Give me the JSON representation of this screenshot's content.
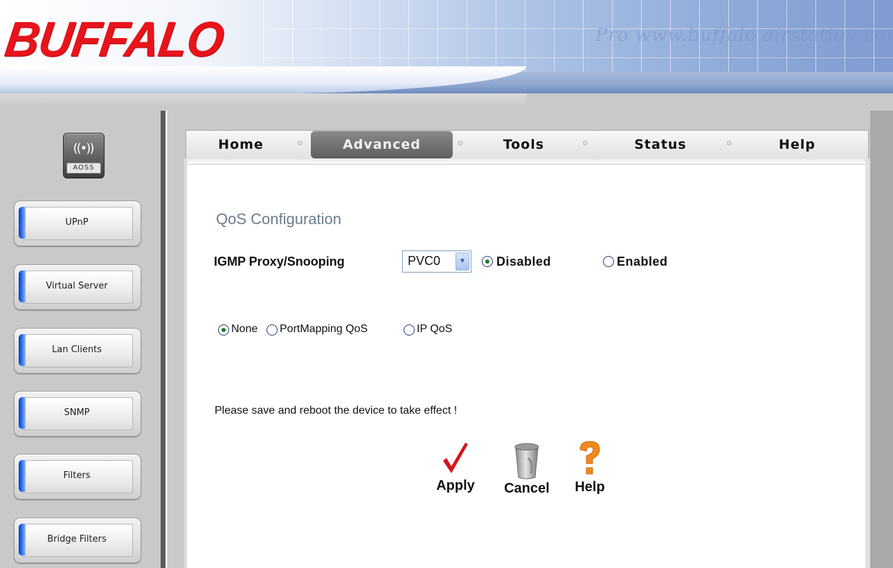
{
  "brand": {
    "logo_text": "BUFFALO",
    "header_script": "Pro www.buffalo airstation.com"
  },
  "sidebar": {
    "aoss_label": "AOSS",
    "items": [
      {
        "label": "UPnP"
      },
      {
        "label": "Virtual Server"
      },
      {
        "label": "Lan Clients"
      },
      {
        "label": "SNMP"
      },
      {
        "label": "Filters"
      },
      {
        "label": "Bridge Filters"
      }
    ]
  },
  "tabs": [
    {
      "label": "Home",
      "active": false
    },
    {
      "label": "Advanced",
      "active": true
    },
    {
      "label": "Tools",
      "active": false
    },
    {
      "label": "Status",
      "active": false
    },
    {
      "label": "Help",
      "active": false
    }
  ],
  "main": {
    "section_title": "QoS Configuration",
    "igmp": {
      "label": "IGMP Proxy/Snooping",
      "pvc_selected": "PVC0",
      "options": [
        {
          "label": "Disabled",
          "checked": true
        },
        {
          "label": "Enabled",
          "checked": false
        }
      ]
    },
    "qos_mode": {
      "options": [
        {
          "label": "None",
          "checked": true
        },
        {
          "label": "PortMapping QoS",
          "checked": false
        },
        {
          "label": "IP QoS",
          "checked": false
        }
      ]
    },
    "notice": "Please save and reboot the device to take effect !",
    "actions": {
      "apply": "Apply",
      "cancel": "Cancel",
      "help": "Help"
    }
  },
  "colors": {
    "logo": "#e8141b",
    "section_title": "#6c7b8c",
    "active_tab": "#5e5e5e",
    "sidebar_tab": "#1f5fe0",
    "apply_check": "#d4141b",
    "help_mark": "#f08a1f"
  }
}
